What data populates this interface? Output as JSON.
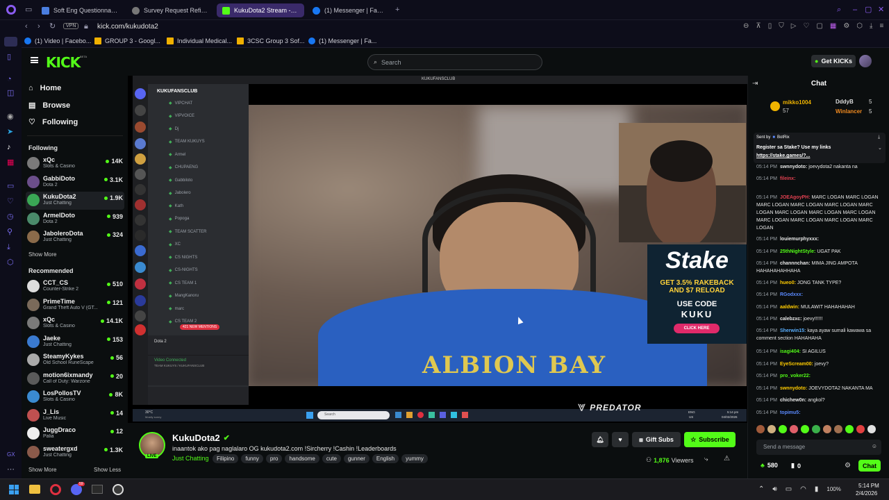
{
  "browser": {
    "tabs": [
      {
        "label": "Soft Eng Questionnaire - G"
      },
      {
        "label": "Survey Request Refineme"
      },
      {
        "label": "KukuDota2 Stream - Wa"
      },
      {
        "label": "(1) Messenger | Facebook"
      }
    ],
    "vpn": "VPN",
    "url": "kick.com/kukudota2",
    "bookmarks": [
      {
        "label": "(1) Video | Facebo..."
      },
      {
        "label": "GROUP 3 - Googl..."
      },
      {
        "label": "Individual Medical..."
      },
      {
        "label": "3CSC Group 3 Sof..."
      },
      {
        "label": "(1) Messenger | Fa..."
      }
    ]
  },
  "kick": {
    "logo": "KICK",
    "beta": "BETA",
    "search_placeholder": "Search",
    "get_kicks": "Get KICKs"
  },
  "nav": {
    "items": [
      {
        "label": "Home"
      },
      {
        "label": "Browse"
      },
      {
        "label": "Following"
      }
    ],
    "following_title": "Following",
    "following": [
      {
        "name": "xQc",
        "cat": "Slots & Casino",
        "viewers": "14K",
        "color": "#7a7a7a"
      },
      {
        "name": "GabbiDoto",
        "cat": "Dota 2",
        "viewers": "3.1K",
        "color": "#6b4e8a"
      },
      {
        "name": "KukuDota2",
        "cat": "Just Chatting",
        "viewers": "1.9K",
        "color": "#3aa655"
      },
      {
        "name": "ArmelDoto",
        "cat": "Dota 2",
        "viewers": "939",
        "color": "#4a8a6a"
      },
      {
        "name": "JaboleroDota",
        "cat": "Just Chatting",
        "viewers": "324",
        "color": "#8a6a4a"
      }
    ],
    "show_more": "Show More",
    "recommended_title": "Recommended",
    "recommended": [
      {
        "name": "CCT_CS",
        "cat": "Counter-Strike 2",
        "viewers": "510",
        "color": "#ddd"
      },
      {
        "name": "PrimeTime",
        "cat": "Grand Theft Auto V (GT...",
        "viewers": "121",
        "color": "#7a6a5a"
      },
      {
        "name": "xQc",
        "cat": "Slots & Casino",
        "viewers": "14.1K",
        "color": "#7a7a7a"
      },
      {
        "name": "Jaeke",
        "cat": "Just Chatting",
        "viewers": "153",
        "color": "#3a7ad0"
      },
      {
        "name": "SteamyKykes",
        "cat": "Old School RuneScape",
        "viewers": "56",
        "color": "#aaa"
      },
      {
        "name": "motion6ixmandy",
        "cat": "Call of Duty: Warzone",
        "viewers": "20",
        "color": "#5a5a5a"
      },
      {
        "name": "LosPollosTV",
        "cat": "Slots & Casino",
        "viewers": "8K",
        "color": "#3a8ad0"
      },
      {
        "name": "J_Lis",
        "cat": "Live Music",
        "viewers": "14",
        "color": "#c05050"
      },
      {
        "name": "JuggDraco",
        "cat": "Palia",
        "viewers": "12",
        "color": "#eee"
      },
      {
        "name": "sweatergxd",
        "cat": "Just Chatting",
        "viewers": "1.3K",
        "color": "#8a5a4a"
      }
    ],
    "show_more2": "Show More",
    "show_less": "Show Less"
  },
  "discord": {
    "server": "KUKUFANSCLUB",
    "window_title": "KUKUFANSCLUB",
    "channels": [
      {
        "label": "VIPCHAT"
      },
      {
        "label": "VIPVOICE"
      },
      {
        "label": "Dj"
      },
      {
        "label": "TEAM KUKUYS"
      },
      {
        "label": "Armel"
      },
      {
        "label": "CHUPAENG"
      },
      {
        "label": "Gabbiloto"
      },
      {
        "label": "Jabolero"
      },
      {
        "label": "Kath"
      },
      {
        "label": "Popoga"
      },
      {
        "label": "TEAM SCATTER"
      },
      {
        "label": "XC"
      },
      {
        "label": "CS NIGHTS"
      },
      {
        "label": "CS-NIGHTS"
      },
      {
        "label": "CS TEAM 1"
      },
      {
        "label": "MangKanoru"
      },
      {
        "label": "marc"
      },
      {
        "label": "CS TEAM 2"
      }
    ],
    "mentions": "421 NEW MENTIONS",
    "game": "Dota 2",
    "video_connected": "Video Connected",
    "conn_sub": "TEAM KUKUYS / KUKUFANSCLUB",
    "weather": "30°C",
    "weather_sub": "Mostly sunny",
    "win_search": "Search",
    "lang": "ENG",
    "region": "US",
    "time": "5:14 pm",
    "date": "04/02/2026"
  },
  "stake": {
    "logo": "Stake",
    "line1": "GET 3.5% RAKEBACK",
    "line2": "AND $7 RELOAD",
    "line3": "USE CODE",
    "line4": "KUKU",
    "cta": "CLICK HERE"
  },
  "predator": "PREDATOR",
  "shirt": "ALBION BAY",
  "stream": {
    "name": "KukuDota2",
    "title": "inaantok ako pag naglalaro OG kukudota2.com !Sircherry !Cashin !Leaderboards",
    "category": "Just Chatting",
    "tags": [
      "Filipino",
      "funny",
      "pro",
      "handsome",
      "cute",
      "gunner",
      "English",
      "yummy"
    ],
    "live": "LIVE",
    "viewers": "1,876",
    "viewers_label": "Viewers",
    "gift": "Gift Subs",
    "subscribe": "Subscribe"
  },
  "chat": {
    "title": "Chat",
    "top_users": [
      {
        "name": "mikko1004",
        "count": "57"
      },
      {
        "name": "DddyB",
        "count": "5"
      },
      {
        "name": "Winlancer",
        "count": "5"
      }
    ],
    "pinned": {
      "sent_by": "Sent by",
      "bot": "BotRix",
      "text": "Register sa Stake? Use my links",
      "link": "https://stake.games/?..."
    },
    "messages": [
      {
        "time": "05:14 PM",
        "user": "swnnydoto:",
        "text": "joevydota2 nakanta na",
        "color": "#e8e8e8"
      },
      {
        "time": "05:14 PM",
        "user": "fileinx:",
        "text": "",
        "color": "#e04050"
      },
      {
        "time": "05:14 PM",
        "user": "JOEAgoyPH:",
        "text": "MARC LOGAN MARC LOGAN MARC LOGAN MARC LOGAN MARC LOGAN MARC LOGAN MARC LOGAN MARC LOGAN MARC LOGAN MARC LOGAN MARC LOGAN MARC LOGAN MARC LOGAN",
        "color": "#e04050"
      },
      {
        "time": "05:14 PM",
        "user": "louiemurphyxxx:",
        "text": "",
        "color": "#e8e8e8"
      },
      {
        "time": "05:14 PM",
        "user": "25thNightStyle:",
        "text": "UGAT PAK",
        "color": "#53fc18"
      },
      {
        "time": "05:14 PM",
        "user": "channnchan:",
        "text": "MIMA JING AMPOTA HAHAHAHAHHAHA",
        "color": "#e8e8e8"
      },
      {
        "time": "05:14 PM",
        "user": "hueo0:",
        "text": "JONG TANK TYPE?",
        "color": "#ffcc00"
      },
      {
        "time": "05:14 PM",
        "user": "RGodxxx:",
        "text": "",
        "color": "#5a8aff"
      },
      {
        "time": "05:14 PM",
        "user": "aaldwin:",
        "text": "MULAWIT HAHAHAHAH",
        "color": "#ffcc00"
      },
      {
        "time": "05:14 PM",
        "user": "calebzxc:",
        "text": "joevy!!!!!!",
        "color": "#e8e8e8"
      },
      {
        "time": "05:14 PM",
        "user": "Sherwin15:",
        "text": "kaya ayaw sumali kawawa sa comment section HAHAHAHA",
        "color": "#5ab0ff"
      },
      {
        "time": "05:14 PM",
        "user": "isagi404:",
        "text": "SI AGILUS",
        "color": "#53fc18"
      },
      {
        "time": "05:14 PM",
        "user": "EyeScream00:",
        "text": "joevy?",
        "color": "#ffcc00"
      },
      {
        "time": "05:14 PM",
        "user": "pro_voker22:",
        "text": "",
        "color": "#53fc18"
      },
      {
        "time": "05:14 PM",
        "user": "swnnydoto:",
        "text": "JOEVYDOTA2 NAKANTA MA",
        "color": "#ffcc00"
      },
      {
        "time": "05:14 PM",
        "user": "chichew0n:",
        "text": "angkol?",
        "color": "#e8e8e8"
      },
      {
        "time": "05:14 PM",
        "user": "topimu5:",
        "text": "",
        "color": "#5a8aff"
      }
    ],
    "placeholder": "Send a message",
    "points": "580",
    "kicks": "0",
    "send": "Chat"
  },
  "taskbar": {
    "time": "5:14 PM",
    "date": "2/4/2026",
    "battery": "100%",
    "discord_badge": "59"
  }
}
